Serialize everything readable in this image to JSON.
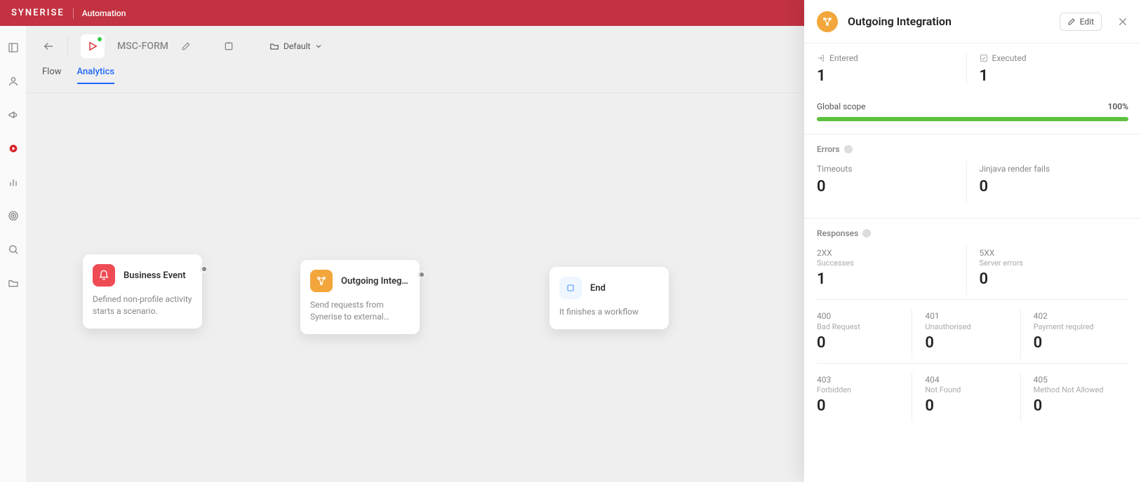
{
  "header": {
    "brand": "synerise",
    "module": "Automation"
  },
  "sidebar_icons": [
    "layout",
    "user",
    "megaphone",
    "play",
    "chart",
    "target",
    "search",
    "folder"
  ],
  "toolbar": {
    "workflow_name": "MSC-FORM",
    "folder_label": "Default"
  },
  "tabs": {
    "flow": "Flow",
    "analytics": "Analytics",
    "active": "analytics"
  },
  "nodes": {
    "n1": {
      "title": "Business Event",
      "desc": "Defined non-profile activity starts a scenario.",
      "color": "#ef4b55"
    },
    "n2": {
      "title": "Outgoing Integr…",
      "desc": "Send requests from Synerise to external…",
      "color": "#f3a63b"
    },
    "n3": {
      "title": "End",
      "desc": "It finishes a workflow",
      "color": "#ffffff"
    }
  },
  "panel": {
    "title": "Outgoing Integration",
    "edit_label": "Edit",
    "entered_label": "Entered",
    "entered_value": "1",
    "executed_label": "Executed",
    "executed_value": "1",
    "scope_label": "Global scope",
    "scope_pct": "100%",
    "errors_header": "Errors",
    "timeouts_label": "Timeouts",
    "timeouts_value": "0",
    "jinja_label": "Jinjava render fails",
    "jinja_value": "0",
    "responses_header": "Responses",
    "r2xx_code": "2XX",
    "r2xx_sub": "Successes",
    "r2xx_value": "1",
    "r5xx_code": "5XX",
    "r5xx_sub": "Server errors",
    "r5xx_value": "0",
    "r401": {
      "code": "401",
      "sub": "Unauthorised",
      "value": "0"
    },
    "r400": {
      "code": "400",
      "sub": "Bad Request",
      "value": "0"
    },
    "r402": {
      "code": "402",
      "sub": "Payment required",
      "value": "0"
    },
    "r403": {
      "code": "403",
      "sub": "Forbidden",
      "value": "0"
    },
    "r404": {
      "code": "404",
      "sub": "Not Found",
      "value": "0"
    },
    "r405": {
      "code": "405",
      "sub": "Method Not Allowed",
      "value": "0"
    }
  }
}
